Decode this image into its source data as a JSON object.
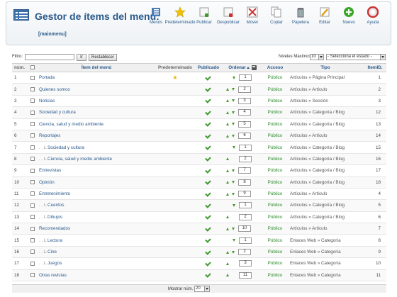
{
  "header": {
    "title": "Gestor de ítems del menú:",
    "menu_tag": "[mainmenu]"
  },
  "toolbar": [
    {
      "name": "menus-button",
      "label": "Menús",
      "icon": "menus-icon"
    },
    {
      "name": "default-button",
      "label": "Predeterminado",
      "icon": "star-icon"
    },
    {
      "name": "publish-button",
      "label": "Publicar",
      "icon": "publish-icon"
    },
    {
      "name": "unpublish-button",
      "label": "Despublicar",
      "icon": "unpublish-icon"
    },
    {
      "name": "move-button",
      "label": "Mover",
      "icon": "move-icon"
    },
    {
      "name": "copy-button",
      "label": "Copiar",
      "icon": "copy-icon"
    },
    {
      "name": "trash-button",
      "label": "Papelera",
      "icon": "trash-icon"
    },
    {
      "name": "edit-button",
      "label": "Editar",
      "icon": "edit-icon"
    },
    {
      "name": "new-button",
      "label": "Nuevo",
      "icon": "new-icon"
    },
    {
      "name": "help-button",
      "label": "Ayuda",
      "icon": "help-icon"
    }
  ],
  "filter": {
    "label": "Filtro:",
    "value": "",
    "go_label": "Ir",
    "reset_label": "Restablecer",
    "levels_label": "Niveles Máximos",
    "levels_value": "10",
    "state_value": "- Selecciona el estado -"
  },
  "columns": {
    "num": "núm.",
    "title": "Ítem del menú",
    "default": "Predeterminado",
    "published": "Publicado",
    "order": "Ordenar",
    "access": "Acceso",
    "type": "Tipo",
    "id": "ItemID."
  },
  "rows": [
    {
      "num": "1",
      "indent": "",
      "title": "Portada",
      "default": true,
      "up": false,
      "down": true,
      "order": "1",
      "access": "Público",
      "type": "Artículos » Página Principal",
      "id": "1"
    },
    {
      "num": "2",
      "indent": "",
      "title": "Quienes somos",
      "default": false,
      "up": true,
      "down": true,
      "order": "2",
      "access": "Público",
      "type": "Artículos » Artículo",
      "id": "2"
    },
    {
      "num": "3",
      "indent": "",
      "title": "Noticias",
      "default": false,
      "up": true,
      "down": true,
      "order": "3",
      "access": "Público",
      "type": "Artículos » Sección",
      "id": "3"
    },
    {
      "num": "4",
      "indent": "",
      "title": "Sociedad y cultura",
      "default": false,
      "up": true,
      "down": true,
      "order": "4",
      "access": "Público",
      "type": "Artículos » Categoría / Blog",
      "id": "12"
    },
    {
      "num": "5",
      "indent": "",
      "title": "Ciencia, salud y medio ambiente",
      "default": false,
      "up": true,
      "down": true,
      "order": "5",
      "access": "Público",
      "type": "Artículos » Categoría / Blog",
      "id": "13"
    },
    {
      "num": "6",
      "indent": "",
      "title": "Reportajes",
      "default": false,
      "up": true,
      "down": true,
      "order": "6",
      "access": "Público",
      "type": "Artículos » Artículo",
      "id": "14"
    },
    {
      "num": "7",
      "indent": ". . L",
      "title": "Sociedad y cultura",
      "default": false,
      "up": false,
      "down": true,
      "order": "1",
      "access": "Público",
      "type": "Artículos » Categoría / Blog",
      "id": "15"
    },
    {
      "num": "8",
      "indent": ". . L",
      "title": "Ciencia, salud y medio ambiente",
      "default": false,
      "up": true,
      "down": false,
      "order": "2",
      "access": "Público",
      "type": "Artículos » Categoría / Blog",
      "id": "16"
    },
    {
      "num": "9",
      "indent": "",
      "title": "Entrevistas",
      "default": false,
      "up": true,
      "down": true,
      "order": "7",
      "access": "Público",
      "type": "Artículos » Categoría / Blog",
      "id": "17"
    },
    {
      "num": "10",
      "indent": "",
      "title": "Opinión",
      "default": false,
      "up": true,
      "down": true,
      "order": "8",
      "access": "Público",
      "type": "Artículos » Categoría / Blog",
      "id": "18"
    },
    {
      "num": "11",
      "indent": "",
      "title": "Entretenimiento",
      "default": false,
      "up": true,
      "down": true,
      "order": "9",
      "access": "Público",
      "type": "Artículos » Artículo",
      "id": "4"
    },
    {
      "num": "12",
      "indent": ". . L",
      "title": "Cuentos",
      "default": false,
      "up": false,
      "down": true,
      "order": "1",
      "access": "Público",
      "type": "Artículos » Categoría / Blog",
      "id": "5"
    },
    {
      "num": "13",
      "indent": ". . L",
      "title": "Dibujos",
      "default": false,
      "up": true,
      "down": false,
      "order": "2",
      "access": "Público",
      "type": "Artículos » Categoría / Blog",
      "id": "6"
    },
    {
      "num": "14",
      "indent": "",
      "title": "Recomendados",
      "default": false,
      "up": true,
      "down": true,
      "order": "10",
      "access": "Público",
      "type": "Artículos » Artículo",
      "id": "7"
    },
    {
      "num": "15",
      "indent": ". . L",
      "title": "Lectura",
      "default": false,
      "up": false,
      "down": true,
      "order": "1",
      "access": "Público",
      "type": "Enlaces Web » Categoría",
      "id": "8"
    },
    {
      "num": "16",
      "indent": ". . L",
      "title": "Cine",
      "default": false,
      "up": true,
      "down": true,
      "order": "2",
      "access": "Público",
      "type": "Enlaces Web » Categoría",
      "id": "9"
    },
    {
      "num": "17",
      "indent": ". . L",
      "title": "Juegos",
      "default": false,
      "up": true,
      "down": false,
      "order": "3",
      "access": "Público",
      "type": "Enlaces Web » Categoría",
      "id": "10"
    },
    {
      "num": "18",
      "indent": "",
      "title": "Otras revistas",
      "default": false,
      "up": true,
      "down": false,
      "order": "11",
      "access": "Público",
      "type": "Enlaces Web » Categoría",
      "id": "11"
    }
  ],
  "footer": {
    "label": "Mostrar núm.",
    "limit_value": "20"
  },
  "colors": {
    "link": "#2a5a8c",
    "published": "#3a9a2a",
    "access": "#2a8a2a"
  }
}
